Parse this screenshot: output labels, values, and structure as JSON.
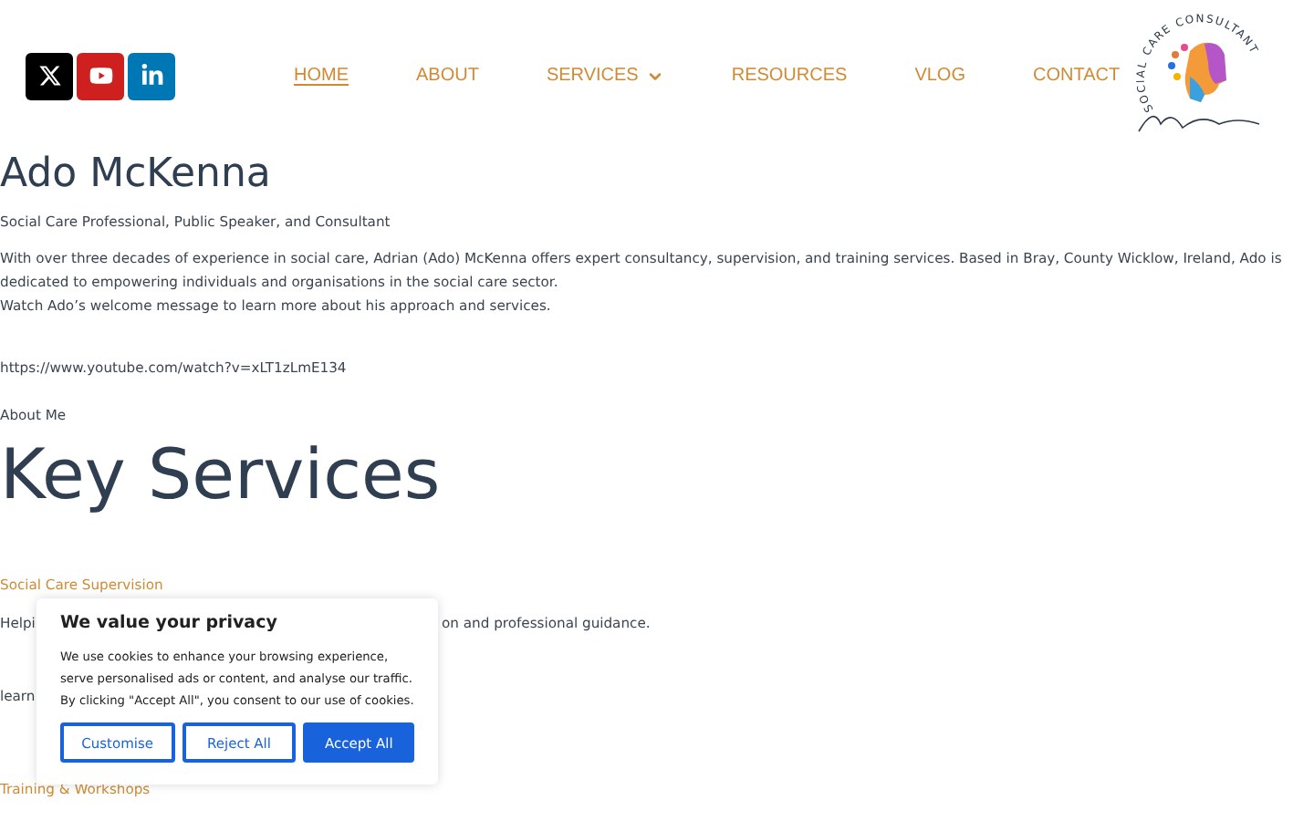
{
  "social_links": [
    {
      "kind": "x"
    },
    {
      "kind": "youtube"
    },
    {
      "kind": "linkedin"
    }
  ],
  "nav": [
    {
      "label": "HOME",
      "selected": true,
      "dropdown": false
    },
    {
      "label": "ABOUT",
      "selected": false,
      "dropdown": false
    },
    {
      "label": "SERVICES",
      "selected": false,
      "dropdown": true
    },
    {
      "label": "RESOURCES",
      "selected": false,
      "dropdown": false
    },
    {
      "label": "VLOG",
      "selected": false,
      "dropdown": false
    },
    {
      "label": "CONTACT",
      "selected": false,
      "dropdown": false
    }
  ],
  "logo": {
    "ring_text": "SOCIAL CARE CONSULTANT"
  },
  "hero": {
    "title": "Ado McKenna",
    "subtitle": "Social Care Professional, Public Speaker, and Consultant",
    "paragraphs": [
      "With over three decades of experience in social care, Adrian (Ado) McKenna offers expert consultancy, supervision, and training services. Based in Bray, County Wicklow, Ireland, Ado is dedicated to empowering individuals and organisations in the social care sector.",
      "Watch Ado’s welcome message to learn more about his approach and services."
    ],
    "video_url": "https://www.youtube.com/watch?v=xLT1zLmE134",
    "about_link": "About Me"
  },
  "services": {
    "title": "Key Services",
    "items": [
      {
        "title": "Social Care Supervision",
        "text_start": "Helpi",
        "text_end": "on and professional guidance.",
        "more": "learn"
      },
      {
        "title": "Training & Workshops"
      }
    ]
  },
  "cookie_banner": {
    "title": "We value your privacy",
    "text": "We use cookies to enhance your browsing experience, serve personalised ads or content, and analyse our traffic. By clicking \"Accept All\", you consent to our use of cookies.",
    "buttons": [
      {
        "label": "Customise",
        "kind": "outline"
      },
      {
        "label": "Reject All",
        "kind": "outline"
      },
      {
        "label": "Accept All",
        "kind": "primary"
      }
    ]
  }
}
